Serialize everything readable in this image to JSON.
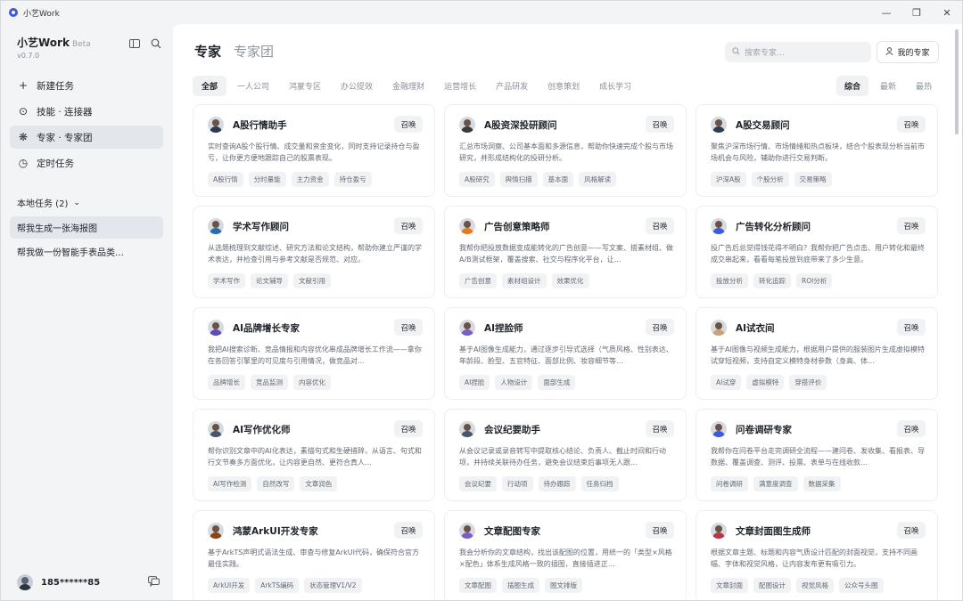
{
  "window": {
    "title": "小艺Work",
    "controls": [
      "minimize-icon",
      "restore-icon",
      "close-icon"
    ]
  },
  "sidebar": {
    "brand": "小艺Work",
    "beta": "Beta",
    "version": "v0.7.0",
    "nav": [
      {
        "label": "新建任务",
        "icon": "plus-icon",
        "glyph": "+"
      },
      {
        "label": "技能 · 连接器",
        "icon": "compass-icon",
        "glyph": "⊙"
      },
      {
        "label": "专家 · 专家团",
        "icon": "experts-icon",
        "glyph": "❋",
        "active": true
      },
      {
        "label": "定时任务",
        "icon": "clock-icon",
        "glyph": "◷"
      }
    ],
    "local_tasks_header": "本地任务 (2)",
    "tasks": [
      {
        "label": "帮我生成一张海报图",
        "active": true
      },
      {
        "label": "帮我做一份智能手表品类…"
      }
    ],
    "user": {
      "phone": "185******85"
    }
  },
  "header": {
    "tabs": [
      "专家",
      "专家团"
    ],
    "search_placeholder": "搜索专家…",
    "my_experts": "我的专家"
  },
  "categories": [
    {
      "label": "全部",
      "active": true
    },
    {
      "label": "一人公司"
    },
    {
      "label": "鸿蒙专区"
    },
    {
      "label": "办公提效"
    },
    {
      "label": "金融理财"
    },
    {
      "label": "运营增长"
    },
    {
      "label": "产品研发"
    },
    {
      "label": "创意策划"
    },
    {
      "label": "成长学习"
    }
  ],
  "sorts": [
    {
      "label": "综合",
      "active": true
    },
    {
      "label": "最新"
    },
    {
      "label": "最热"
    }
  ],
  "call_label": "召唤",
  "experts": [
    {
      "title": "A股行情助手",
      "shirt": "#2e3a4d",
      "desc": "实时查询A股个股行情、成交量和资金变化，同时支持记录持仓与盈亏，让你更方便地跟踪自己的股票表现。",
      "tags": [
        "A股行情",
        "分时量能",
        "主力资金",
        "持仓盈亏"
      ]
    },
    {
      "title": "A股资深投研顾问",
      "shirt": "#3a3a3a",
      "desc": "汇总市场洞察、公司基本面和多源信息，帮助你快速完成个股与市场研究，并形成结构化的投研分析。",
      "tags": [
        "A股研究",
        "舆情扫描",
        "基本面",
        "风格解读"
      ]
    },
    {
      "title": "A股交易顾问",
      "shirt": "#2f3b52",
      "desc": "聚焦沪深市场行情、市场情绪和热点板块，结合个股表现分析当前市场机会与风险，辅助你进行交易判断。",
      "tags": [
        "沪深A股",
        "个股分析",
        "交易策略"
      ]
    },
    {
      "title": "学术写作顾问",
      "shirt": "#2b6cb0",
      "desc": "从选题梳理到文献综述、研究方法和论文结构，帮助你建立严谨的学术表达，并检查引用与参考文献是否规范、对应。",
      "tags": [
        "学术写作",
        "论文辅导",
        "文献引用"
      ]
    },
    {
      "title": "广告创意策略师",
      "shirt": "#e07b24",
      "desc": "我帮你把投放数据变成能转化的广告创意——写文案、搭素材组、做A/B测试框架，覆盖搜索、社交与程序化平台，让…",
      "tags": [
        "广告创意",
        "素材组设计",
        "效果优化"
      ]
    },
    {
      "title": "广告转化分析顾问",
      "shirt": "#3b5bdb",
      "desc": "投广告后总觉得钱花得不明白？我帮你把广告点击、用户转化和最终成交串起来，看看每笔投放到底带来了多少生意。",
      "tags": [
        "投放分析",
        "转化追踪",
        "ROI分析"
      ]
    },
    {
      "title": "AI品牌增长专家",
      "shirt": "#5b4ab8",
      "desc": "我把AI搜索诊断、竞品情报和内容优化串成品牌增长工作流——拿你在各回答引擎里的可见度与引用情况，做竞品对…",
      "tags": [
        "品牌增长",
        "竞品监测",
        "内容优化"
      ]
    },
    {
      "title": "AI捏脸师",
      "shirt": "#7a5fc2",
      "desc": "基于AI图像生成能力，通过逐步引导式选择（气质风格、性别表达、年龄段、脸型、五官特征、面部比例、妆容细节等…",
      "tags": [
        "AI捏脸",
        "人物设计",
        "面部生成"
      ]
    },
    {
      "title": "AI试衣间",
      "shirt": "#c9a27a",
      "desc": "基于AI图像与视频生成能力，根据用户提供的服装图片生成虚拟模特试穿短视频，支持自定义模特身材参数（身高、体…",
      "tags": [
        "AI试穿",
        "虚拟模特",
        "穿搭评价"
      ]
    },
    {
      "title": "AI写作优化师",
      "shirt": "#4a5568",
      "desc": "帮你识别文章中的AI化表达，素描句式和生硬措辞，从语言、句式和行文节奏多方面优化，让内容更自然、更符合真人…",
      "tags": [
        "AI写作检测",
        "自然改写",
        "文章润色"
      ]
    },
    {
      "title": "会议纪要助手",
      "shirt": "#4a5568",
      "desc": "从会议记录或录音转写中提取核心结论、负责人、截止时间和行动项，并持续关联待办任务，避免会议结束后事项无人跟…",
      "tags": [
        "会议纪要",
        "行动项",
        "待办跟踪",
        "任务归档"
      ]
    },
    {
      "title": "问卷调研专家",
      "shirt": "#3b5bdb",
      "desc": "我帮你在问卷平台走完调研全流程——建问卷、发收集、看报表、导数据、覆盖调查、测评、投票、表单与在线收款…",
      "tags": [
        "问卷调研",
        "满意度调查",
        "数据采集"
      ]
    },
    {
      "title": "鸿蒙ArkUI开发专家",
      "shirt": "#8b4513",
      "desc": "基于ArkTS声明式语法生成、审查与修复ArkUI代码，确保符合官方最佳实践。",
      "tags": [
        "ArkUI开发",
        "ArkTS编码",
        "状态管理V1/V2"
      ]
    },
    {
      "title": "文章配图专家",
      "shirt": "#7a5fc2",
      "desc": "我会分析你的文章结构，找出该配图的位置，用统一的「类型×风格×配色」体系生成风格一致的插图，直接插进正…",
      "tags": [
        "文章配图",
        "插图生成",
        "图文排版"
      ]
    },
    {
      "title": "文章封面图生成师",
      "shirt": "#b23a48",
      "desc": "根据文章主题、标题和内容气质设计匹配的封面视觉，支持不同画幅、字体和视觉风格，让内容发布更有吸引力。",
      "tags": [
        "文章封面",
        "配图设计",
        "视觉风格",
        "公众号头图"
      ]
    }
  ]
}
